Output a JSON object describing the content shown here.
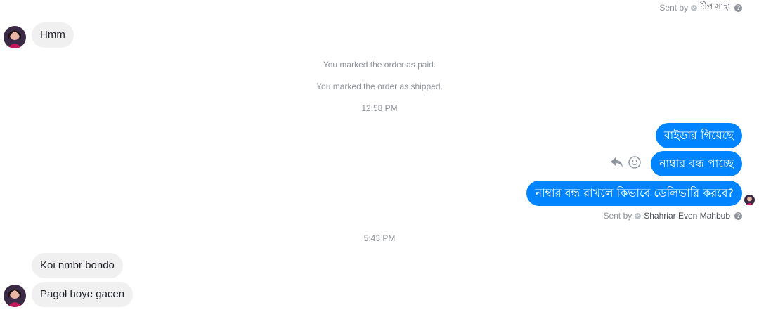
{
  "top_sent": {
    "prefix": "Sent by",
    "name": "দীপ সাহা"
  },
  "incoming_1": {
    "text": "Hmm"
  },
  "system": {
    "paid": "You marked the order as paid.",
    "shipped": "You marked the order as shipped."
  },
  "time_1": "12:58 PM",
  "outgoing": [
    {
      "text": "রাইডার গিয়েছে"
    },
    {
      "text": "নাম্বার বন্ধ পাচ্ছে"
    },
    {
      "text": "নাম্বার বন্ধ রাখলে কিভাবে ডেলিভারি করবে?"
    }
  ],
  "bottom_sent": {
    "prefix": "Sent by",
    "name": "Shahriar Even Mahbub"
  },
  "help_glyph": "?",
  "time_2": "5:43 PM",
  "incoming_2": [
    {
      "text": "Koi nmbr bondo"
    },
    {
      "text": "Pagol hoye gacen"
    }
  ],
  "colors": {
    "outgoing_bubble": "#0084ff",
    "incoming_bubble": "#f1f0f0",
    "meta_text": "#90949c"
  },
  "icons": [
    "verified-badge-icon",
    "help-icon",
    "reply-icon",
    "emoji-reaction-icon",
    "avatar"
  ]
}
